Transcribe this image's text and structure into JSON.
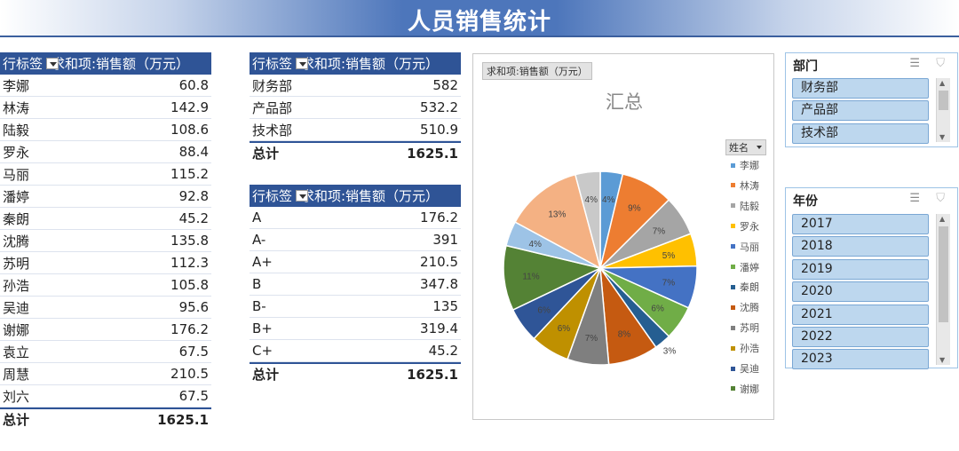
{
  "title": "人员销售统计",
  "pivot_person": {
    "col1": "行标签",
    "col2": "求和项:销售额（万元）",
    "rows": [
      {
        "k": "李娜",
        "v": "60.8"
      },
      {
        "k": "林涛",
        "v": "142.9"
      },
      {
        "k": "陆毅",
        "v": "108.6"
      },
      {
        "k": "罗永",
        "v": "88.4"
      },
      {
        "k": "马丽",
        "v": "115.2"
      },
      {
        "k": "潘婷",
        "v": "92.8"
      },
      {
        "k": "秦朗",
        "v": "45.2"
      },
      {
        "k": "沈腾",
        "v": "135.8"
      },
      {
        "k": "苏明",
        "v": "112.3"
      },
      {
        "k": "孙浩",
        "v": "105.8"
      },
      {
        "k": "吴迪",
        "v": "95.6"
      },
      {
        "k": "谢娜",
        "v": "176.2"
      },
      {
        "k": "袁立",
        "v": "67.5"
      },
      {
        "k": "周慧",
        "v": "210.5"
      },
      {
        "k": "刘六",
        "v": "67.5"
      }
    ],
    "total_label": "总计",
    "total": "1625.1"
  },
  "pivot_dept": {
    "col1": "行标签",
    "col2": "求和项:销售额（万元）",
    "rows": [
      {
        "k": "财务部",
        "v": "582"
      },
      {
        "k": "产品部",
        "v": "532.2"
      },
      {
        "k": "技术部",
        "v": "510.9"
      }
    ],
    "total_label": "总计",
    "total": "1625.1"
  },
  "pivot_grade": {
    "col1": "行标签",
    "col2": "求和项:销售额（万元）",
    "rows": [
      {
        "k": "A",
        "v": "176.2"
      },
      {
        "k": "A-",
        "v": "391"
      },
      {
        "k": "A+",
        "v": "210.5"
      },
      {
        "k": "B",
        "v": "347.8"
      },
      {
        "k": "B-",
        "v": "135"
      },
      {
        "k": "B+",
        "v": "319.4"
      },
      {
        "k": "C+",
        "v": "45.2"
      }
    ],
    "total_label": "总计",
    "total": "1625.1"
  },
  "chart": {
    "field_button": "求和项:销售额（万元）",
    "legend_button": "姓名",
    "legend_items": [
      "李娜",
      "林涛",
      "陆毅",
      "罗永",
      "马丽",
      "潘婷",
      "秦朗",
      "沈腾",
      "苏明",
      "孙浩",
      "吴迪",
      "谢娜"
    ]
  },
  "chart_data": {
    "type": "pie",
    "title": "汇总",
    "labels": [
      "李娜",
      "林涛",
      "陆毅",
      "罗永",
      "马丽",
      "潘婷",
      "秦朗",
      "沈腾",
      "苏明",
      "孙浩",
      "吴迪",
      "谢娜",
      "袁立",
      "周慧",
      "刘六"
    ],
    "values": [
      60.8,
      142.9,
      108.6,
      88.4,
      115.2,
      92.8,
      45.2,
      135.8,
      112.3,
      105.8,
      95.6,
      176.2,
      67.5,
      210.5,
      67.5
    ],
    "percent_labels": [
      "4%",
      "9%",
      "7%",
      "5%",
      "7%",
      "6%",
      "3%",
      "8%",
      "7%",
      "6%",
      "6%",
      "11%",
      "4%",
      "13%",
      "4%"
    ],
    "colors": [
      "#5b9bd5",
      "#ed7d31",
      "#a5a5a5",
      "#ffc000",
      "#4472c4",
      "#70ad47",
      "#255e91",
      "#c55a11",
      "#7f7f7f",
      "#bf9000",
      "#2f5597",
      "#548235",
      "#9dc3e6",
      "#f4b183",
      "#c9c9c9"
    ],
    "legend_position": "right"
  },
  "slicer_dept": {
    "header": "部门",
    "multi_select_icon": "☰",
    "clear_icon": "⛉",
    "items": [
      "财务部",
      "产品部",
      "技术部"
    ]
  },
  "slicer_year": {
    "header": "年份",
    "multi_select_icon": "☰",
    "clear_icon": "⛉",
    "items": [
      "2017",
      "2018",
      "2019",
      "2020",
      "2021",
      "2022",
      "2023"
    ]
  }
}
